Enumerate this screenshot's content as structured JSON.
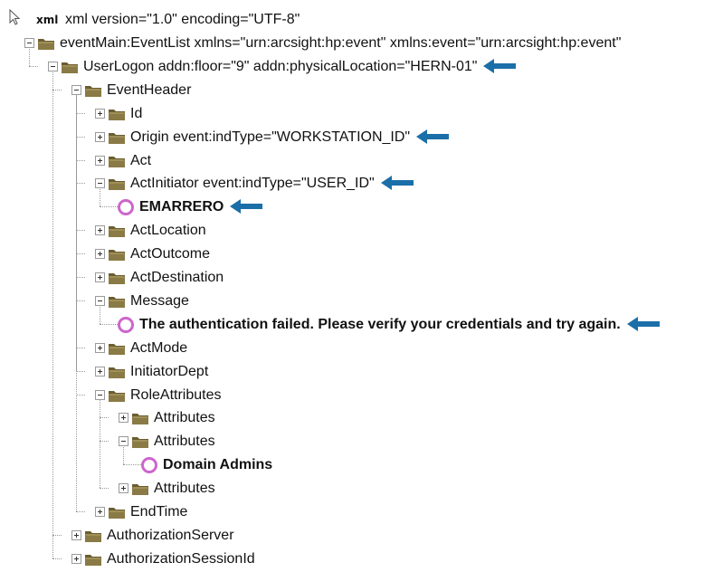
{
  "declaration": {
    "tag": "xml",
    "text": "xml version=\"1.0\" encoding=\"UTF-8\""
  },
  "nodes": [
    {
      "level": 0,
      "kind": "folder",
      "expander": "minus",
      "label": "eventMain:EventList xmlns=\"urn:arcsight:hp:event\"  xmlns:event=\"urn:arcsight:hp:event\"",
      "arrow": false
    },
    {
      "level": 1,
      "kind": "folder",
      "expander": "minus",
      "label": "UserLogon addn:floor=\"9\"  addn:physicalLocation=\"HERN-01\"",
      "arrow": true
    },
    {
      "level": 2,
      "kind": "folder",
      "expander": "minus",
      "label": "EventHeader",
      "arrow": false
    },
    {
      "level": 3,
      "kind": "folder",
      "expander": "plus",
      "label": "Id",
      "arrow": false
    },
    {
      "level": 3,
      "kind": "folder",
      "expander": "plus",
      "label": "Origin event:indType=\"WORKSTATION_ID\"",
      "arrow": true
    },
    {
      "level": 3,
      "kind": "folder",
      "expander": "plus",
      "label": "Act",
      "arrow": false
    },
    {
      "level": 3,
      "kind": "folder",
      "expander": "minus",
      "label": "ActInitiator event:indType=\"USER_ID\"",
      "arrow": true
    },
    {
      "level": 4,
      "kind": "text",
      "expander": "none",
      "label": "EMARRERO",
      "arrow": true
    },
    {
      "level": 3,
      "kind": "folder",
      "expander": "plus",
      "label": "ActLocation",
      "arrow": false
    },
    {
      "level": 3,
      "kind": "folder",
      "expander": "plus",
      "label": "ActOutcome",
      "arrow": false
    },
    {
      "level": 3,
      "kind": "folder",
      "expander": "plus",
      "label": "ActDestination",
      "arrow": false
    },
    {
      "level": 3,
      "kind": "folder",
      "expander": "minus",
      "label": "Message",
      "arrow": false
    },
    {
      "level": 4,
      "kind": "text",
      "expander": "none",
      "label": "The authentication failed. Please verify your credentials and try again.",
      "arrow": true
    },
    {
      "level": 3,
      "kind": "folder",
      "expander": "plus",
      "label": "ActMode",
      "arrow": false
    },
    {
      "level": 3,
      "kind": "folder",
      "expander": "plus",
      "label": "InitiatorDept",
      "arrow": false
    },
    {
      "level": 3,
      "kind": "folder",
      "expander": "minus",
      "label": "RoleAttributes",
      "arrow": false
    },
    {
      "level": 4,
      "kind": "folder",
      "expander": "plus",
      "label": "Attributes",
      "arrow": false
    },
    {
      "level": 4,
      "kind": "folder",
      "expander": "minus",
      "label": "Attributes",
      "arrow": false
    },
    {
      "level": 5,
      "kind": "text",
      "expander": "none",
      "label": "Domain Admins",
      "arrow": false
    },
    {
      "level": 4,
      "kind": "folder",
      "expander": "plus",
      "label": "Attributes",
      "arrow": false
    },
    {
      "level": 3,
      "kind": "folder",
      "expander": "plus",
      "label": "EndTime",
      "arrow": false
    },
    {
      "level": 2,
      "kind": "folder",
      "expander": "plus",
      "label": "AuthorizationServer",
      "arrow": false
    },
    {
      "level": 2,
      "kind": "folder",
      "expander": "plus",
      "label": "AuthorizationSessionId",
      "arrow": false
    }
  ],
  "colors": {
    "folder": "#8a7a45",
    "folder_dark": "#6b5d30",
    "text_node_ring": "#cc66cc",
    "arrow": "#1b6fa8",
    "guide_line": "#9a9a9a"
  },
  "icons": {
    "folder": "folder-icon",
    "text_node": "text-node-icon",
    "arrow": "arrow-left-icon",
    "expander_plus": "expand-icon",
    "expander_minus": "collapse-icon",
    "cursor": "mouse-cursor-icon"
  }
}
